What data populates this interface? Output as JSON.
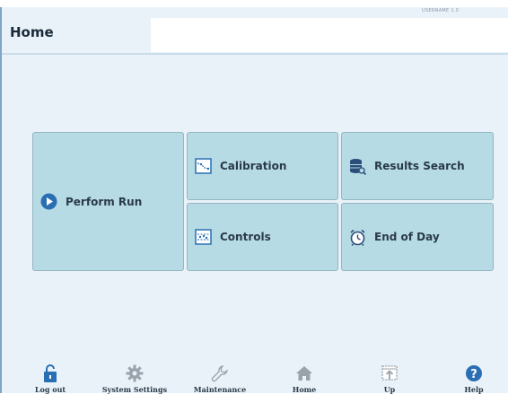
{
  "header": {
    "title": "Home",
    "user_tag": "USERNAME 1.0"
  },
  "tiles": {
    "perform_run": "Perform Run",
    "calibration": "Calibration",
    "results_search": "Results Search",
    "controls": "Controls",
    "end_of_day": "End of Day"
  },
  "nav": {
    "logout": "Log out",
    "system_settings": "System Settings",
    "maintenance": "Maintenance",
    "home": "Home",
    "up": "Up",
    "help": "Help"
  },
  "colors": {
    "background": "#eaf2f9",
    "tile": "#b6dbe5",
    "accent": "#2a6fb3"
  }
}
